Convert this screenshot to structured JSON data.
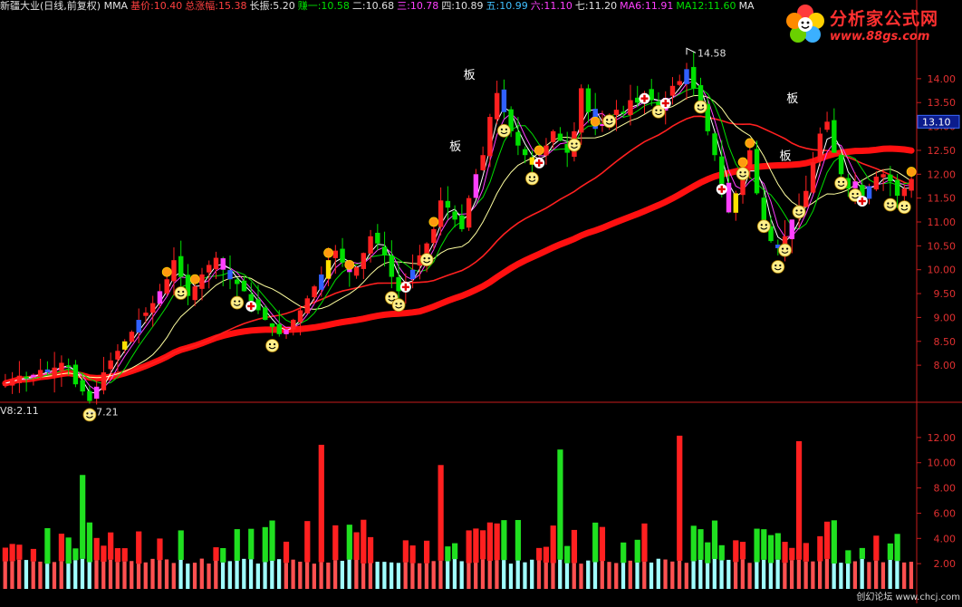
{
  "header": {
    "title": "新疆大业(日线,前复权) MMA",
    "items": [
      {
        "text": "基价:10.40",
        "color": "#ff4040"
      },
      {
        "text": "总涨幅:15.38",
        "color": "#ff4040"
      },
      {
        "text": "长振:5.20",
        "color": "#e0e0e0"
      },
      {
        "text": "赚一:10.58",
        "color": "#00e000"
      },
      {
        "text": "二:10.68",
        "color": "#e0e0e0"
      },
      {
        "text": "三:10.78",
        "color": "#ff40ff"
      },
      {
        "text": "四:10.89",
        "color": "#e0e0e0"
      },
      {
        "text": "五:10.99",
        "color": "#40c0ff"
      },
      {
        "text": "六:11.10",
        "color": "#ff40ff"
      },
      {
        "text": "七:11.20",
        "color": "#e0e0e0"
      },
      {
        "text": "MA6:11.91",
        "color": "#ff40ff"
      },
      {
        "text": "MA12:11.60",
        "color": "#00e000"
      },
      {
        "text": "MA",
        "color": "#e0e0e0"
      }
    ]
  },
  "volume_header": "V8:2.11",
  "logo": {
    "name": "分析家公式网",
    "url": "www.88gs.com"
  },
  "watermark": "创幻论坛 www.chcj.com",
  "price_badge": "13.10",
  "annotations": {
    "high": "14.58",
    "low": "←7.21",
    "board_labels": [
      "板",
      "板",
      "板",
      "板"
    ]
  },
  "colors": {
    "up": "#ff2020",
    "down": "#00e000",
    "long_ma": "#ff1010",
    "axis": "#c81c1c",
    "vol_up": "#ff2020",
    "vol_down": "#20e020",
    "vol_base_up": "#ff5050",
    "vol_base_down": "#a0ffff"
  },
  "chart_data": [
    {
      "type": "candlestick",
      "title": "新疆大业(日线,前复权) MMA",
      "ylabel": "",
      "ylim": [
        7.3,
        14.7
      ],
      "y_ticks": [
        "8.00",
        "8.50",
        "9.00",
        "9.50",
        "10.00",
        "10.50",
        "11.00",
        "11.50",
        "12.00",
        "12.50",
        "13.00",
        "13.50",
        "14.00"
      ],
      "n_bars": 130,
      "close": [
        7.62,
        7.7,
        7.78,
        7.72,
        7.8,
        7.9,
        7.85,
        7.95,
        8.05,
        7.98,
        7.6,
        7.45,
        7.25,
        7.55,
        7.85,
        8.1,
        8.3,
        8.5,
        8.7,
        8.95,
        9.1,
        9.3,
        9.55,
        9.8,
        10.2,
        9.85,
        9.45,
        9.65,
        9.9,
        10.1,
        10.25,
        10.0,
        9.8,
        9.7,
        9.55,
        9.35,
        9.15,
        8.95,
        8.8,
        8.65,
        8.75,
        8.95,
        9.15,
        9.4,
        9.65,
        9.9,
        10.2,
        10.4,
        10.15,
        9.95,
        10.05,
        10.35,
        10.7,
        10.55,
        10.3,
        9.85,
        9.55,
        9.75,
        10.0,
        10.3,
        10.55,
        10.85,
        11.45,
        11.3,
        11.05,
        10.85,
        11.5,
        12.0,
        12.4,
        13.2,
        13.7,
        13.3,
        12.9,
        12.6,
        12.4,
        12.2,
        12.35,
        12.6,
        12.9,
        12.7,
        12.45,
        12.9,
        13.8,
        13.3,
        12.95,
        13.05,
        13.2,
        13.35,
        13.3,
        13.55,
        13.5,
        13.7,
        13.55,
        13.4,
        13.6,
        13.85,
        13.95,
        14.2,
        13.8,
        13.4,
        12.9,
        12.4,
        11.8,
        11.2,
        11.6,
        12.1,
        12.5,
        11.6,
        11.0,
        10.6,
        10.45,
        10.7,
        11.05,
        11.3,
        11.65,
        12.25,
        12.85,
        13.1,
        12.45,
        12.0,
        11.7,
        11.85,
        11.55,
        11.75,
        11.95,
        12.0,
        11.85,
        11.55,
        11.7,
        11.9
      ],
      "moving_average_long": "thick red line rising from about 7.6 to about 11.4"
    },
    {
      "type": "bar",
      "title": "V8:2.11",
      "ylim": [
        0,
        13.5
      ],
      "y_ticks": [
        "2.00",
        "4.00",
        "6.00",
        "8.00",
        "10.00",
        "12.00"
      ],
      "n_bars": 130
    }
  ]
}
